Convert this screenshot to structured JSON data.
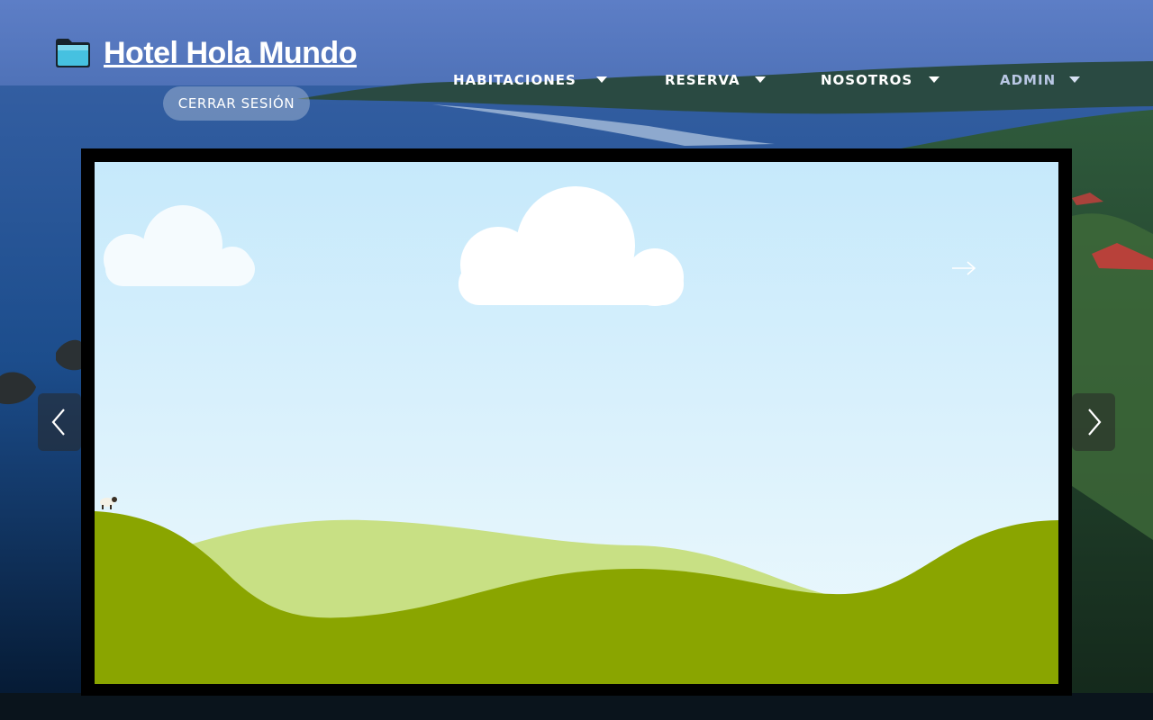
{
  "site": {
    "title": "Hotel Hola Mundo",
    "logo_icon": "folder-icon",
    "logout_label": "CERRAR SESIÓN"
  },
  "nav": {
    "items": [
      {
        "label": "HABITACIONES",
        "icon": "caret-down-icon"
      },
      {
        "label": "RESERVA",
        "icon": "caret-down-icon"
      },
      {
        "label": "NOSOTROS",
        "icon": "caret-down-icon"
      },
      {
        "label": "ADMIN",
        "icon": "caret-down-icon"
      }
    ]
  },
  "carousel": {
    "prev_icon": "chevron-left-icon",
    "next_icon": "chevron-right-icon",
    "slide_hint_icon": "arrow-right-icon",
    "slide_picture": "placeholder-landscape"
  },
  "colors": {
    "accent_hill": "#8aa500",
    "light_hill": "#c8e084",
    "sky_top": "#c6e9fb",
    "sky_bottom": "#eef9fd",
    "frame": "#000000"
  }
}
